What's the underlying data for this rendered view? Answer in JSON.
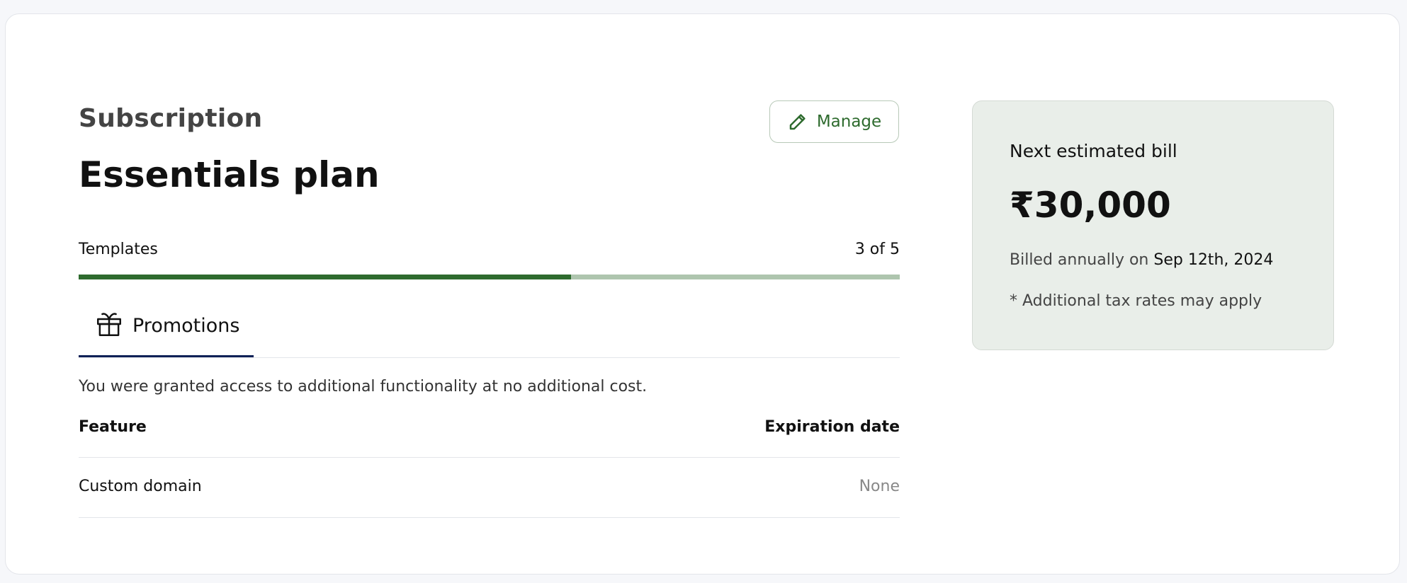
{
  "subscription": {
    "heading": "Subscription",
    "plan_name": "Essentials plan",
    "manage_label": "Manage",
    "usage": {
      "label": "Templates",
      "count_text": "3 of 5",
      "used": 3,
      "total": 5
    }
  },
  "promotions": {
    "tab_label": "Promotions",
    "description": "You were granted access to additional functionality at no additional cost.",
    "columns": [
      "Feature",
      "Expiration date"
    ],
    "rows": [
      {
        "feature": "Custom domain",
        "expiration": "None"
      }
    ]
  },
  "bill": {
    "label": "Next estimated bill",
    "amount": "₹30,000",
    "billed_prefix": "Billed annually on",
    "billed_date": "Sep 12th, 2024",
    "note": "* Additional tax rates may apply"
  },
  "colors": {
    "accent": "#2e6b2e",
    "accent_light": "#aec5ae",
    "tab_underline": "#0e2157",
    "bill_bg": "#e9eee9"
  },
  "icons": {
    "manage": "pencil-icon",
    "promotions": "gift-icon"
  }
}
